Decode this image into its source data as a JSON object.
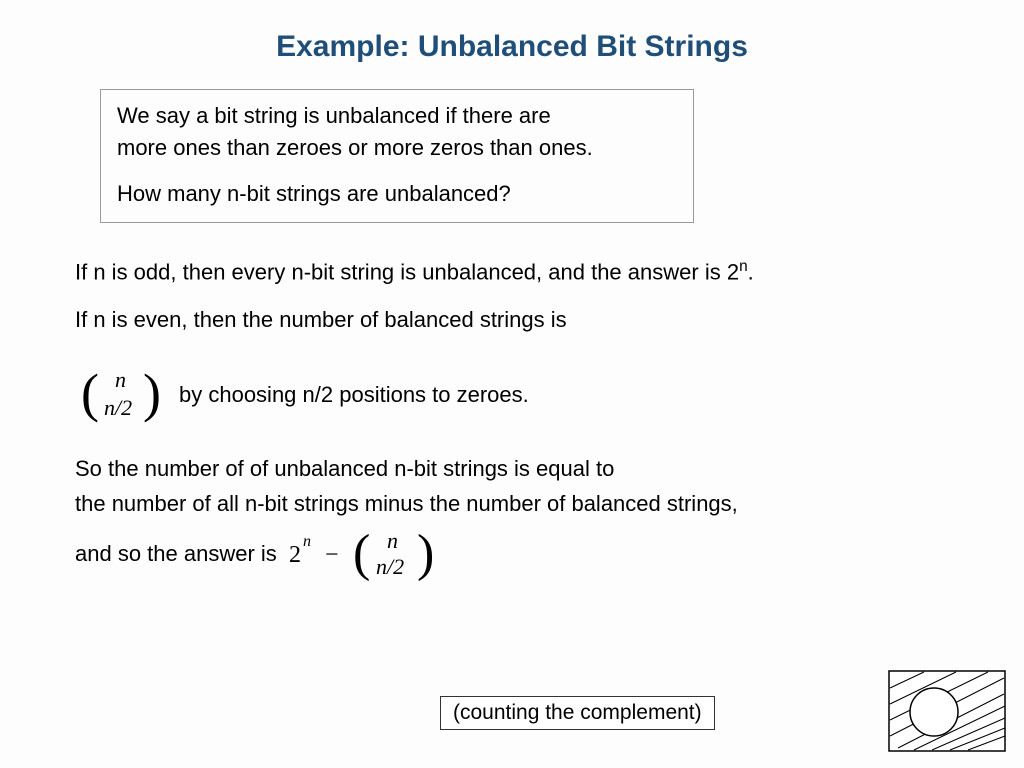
{
  "title": "Example: Unbalanced Bit Strings",
  "def": {
    "line1a": "We say a bit string is unbalanced if there are",
    "line1b": "more ones than zeroes or more zeros than ones.",
    "line2": "How many n-bit strings are unbalanced?"
  },
  "body": {
    "odd_pre": "If n is odd, then every n-bit string is unbalanced, and the answer is 2",
    "odd_sup": "n",
    "odd_post": ".",
    "even_intro": "If n is even, then the number of balanced strings is",
    "binom_top": "n",
    "binom_bot": "n/2",
    "even_after": "by choosing n/2 positions to zeroes.",
    "concl1": "So the number of of unbalanced n-bit strings is equal to",
    "concl2": "the number of all n-bit strings minus the number of balanced strings,",
    "concl3": "and so the answer is",
    "pow_base": "2",
    "pow_exp": "n",
    "minus": "−",
    "binom2_top": "n",
    "binom2_bot": "n/2"
  },
  "complement": "(counting the complement)"
}
